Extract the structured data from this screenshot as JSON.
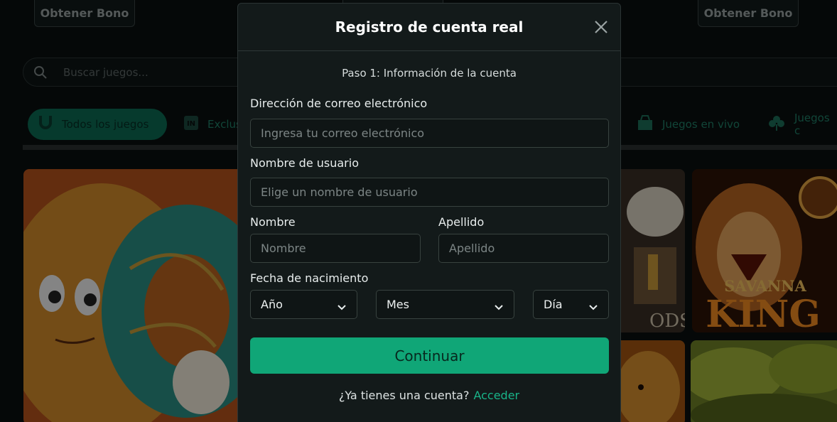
{
  "background": {
    "bonus_label": "Obtener Bono",
    "search_placeholder": "Buscar juegos...",
    "categories": [
      {
        "label": "Todos los juegos",
        "icon": "horseshoe-icon",
        "active": true
      },
      {
        "label": "Exclus",
        "icon": "exclusive-icon"
      },
      {
        "label": "Juegos en vivo",
        "icon": "live-games-icon"
      },
      {
        "label": "Juegos c",
        "icon": "clover-icon"
      }
    ],
    "tiles": [
      {
        "name": "donut-game-tile"
      },
      {
        "name": "gods-game-tile",
        "text": "ODS II"
      },
      {
        "name": "savanna-king-tile",
        "text_top": "SAVANNA",
        "text_main": "KING"
      },
      {
        "name": "lion-game-tile"
      },
      {
        "name": "jungle-game-tile"
      }
    ]
  },
  "modal": {
    "title": "Registro de cuenta real",
    "step": "Paso 1: Información de la cuenta",
    "email_label": "Dirección de correo electrónico",
    "email_placeholder": "Ingresa tu correo electrónico",
    "username_label": "Nombre de usuario",
    "username_placeholder": "Elige un nombre de usuario",
    "first_name_label": "Nombre",
    "first_name_placeholder": "Nombre",
    "last_name_label": "Apellido",
    "last_name_placeholder": "Apellido",
    "dob_label": "Fecha de nacimiento",
    "dob_year": "Año",
    "dob_month": "Mes",
    "dob_day": "Día",
    "continue_label": "Continuar",
    "have_account": "¿Ya tienes una cuenta?",
    "login_label": "Acceder"
  },
  "colors": {
    "accent": "#10a677",
    "link": "#19b489",
    "modal_bg": "#131a1a"
  }
}
